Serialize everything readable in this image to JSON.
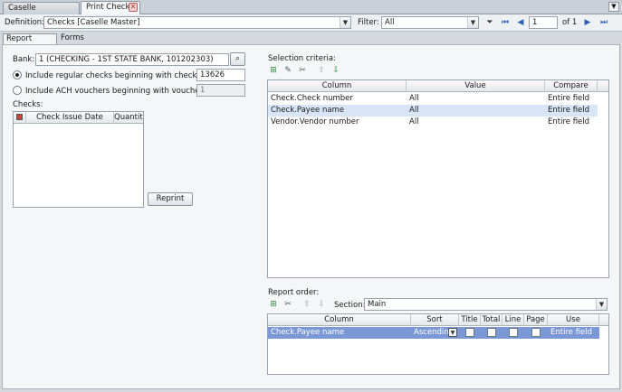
{
  "tabs": [
    {
      "label": "Caselle Connect®"
    },
    {
      "label": "Print Checks"
    }
  ],
  "definition": {
    "label": "Definition:",
    "value": "Checks [Caselle Master]"
  },
  "filter": {
    "label": "Filter:",
    "value": "All"
  },
  "pager": {
    "page": "1",
    "of_label": "of 1"
  },
  "subtabs": [
    {
      "label": "Report Options"
    },
    {
      "label": "Forms"
    }
  ],
  "bank": {
    "label": "Bank:",
    "value": "1 (CHECKING - 1ST STATE BANK, 101202303)"
  },
  "regular_checks": {
    "label": "Include regular checks beginning with check number:",
    "value": "13626"
  },
  "ach_vouchers": {
    "label": "Include ACH vouchers beginning with voucher number:",
    "value": "1"
  },
  "checks": {
    "label": "Checks:",
    "columns": [
      "Check Issue Date",
      "Quantity"
    ]
  },
  "reprint_label": "Reprint",
  "selection": {
    "label": "Selection criteria:",
    "columns": [
      "Column",
      "Value",
      "Compare"
    ],
    "rows": [
      {
        "column": "Check.Check number",
        "value": "All",
        "compare": "Entire field"
      },
      {
        "column": "Check.Payee name",
        "value": "All",
        "compare": "Entire field"
      },
      {
        "column": "Vendor.Vendor number",
        "value": "All",
        "compare": "Entire field"
      }
    ]
  },
  "report_order": {
    "label": "Report order:",
    "section_label": "Section:",
    "section_value": "Main",
    "columns": [
      "Column",
      "Sort",
      "Title",
      "Total",
      "Line",
      "Page",
      "Use"
    ],
    "rows": [
      {
        "column": "Check.Payee name",
        "sort": "Ascending",
        "use": "Entire field"
      }
    ]
  },
  "colors": {
    "selected_row": "#d7e5f7",
    "highlight_row": "#7a98d6",
    "accent": "#2b5fb5"
  }
}
